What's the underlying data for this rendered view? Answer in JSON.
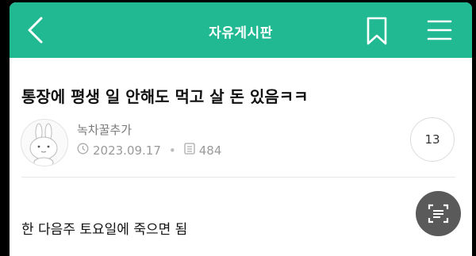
{
  "header": {
    "title": "자유게시판",
    "back_icon": "chevron-left-icon",
    "bookmark_icon": "bookmark-icon",
    "menu_icon": "hamburger-menu-icon",
    "background_color": "#20b992"
  },
  "post": {
    "title": "통장에 평생 일 안해도 먹고 살 돈 있음ㅋㅋ",
    "author": "녹차꿀추가",
    "date": "2023.09.17",
    "views": "484",
    "comment_count": "13",
    "body": "한 다음주 토요일에 죽으면 됨"
  },
  "floating": {
    "scan_icon": "text-scan-icon"
  }
}
